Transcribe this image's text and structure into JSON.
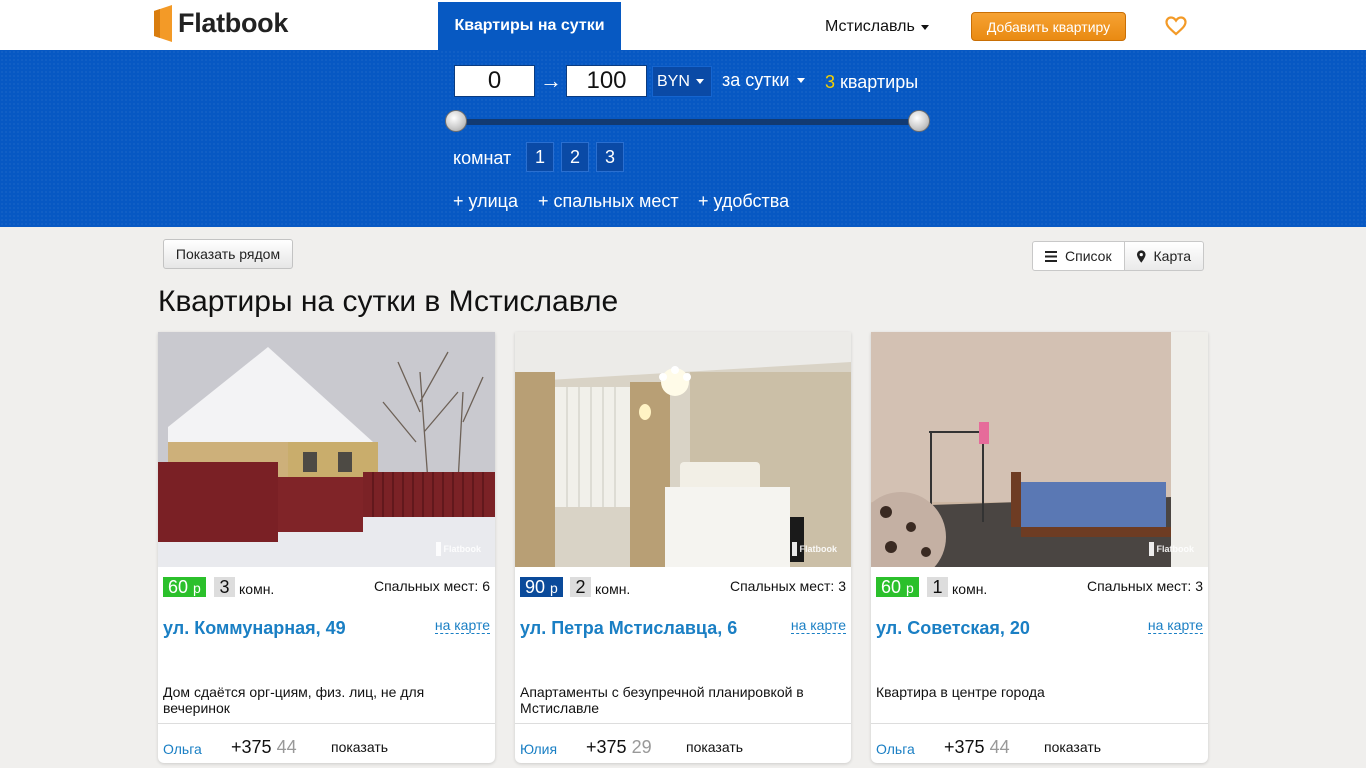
{
  "header": {
    "logo_text": "Flatbook",
    "nav_tab": "Квартиры на сутки",
    "city": "Мстиславль",
    "add_button": "Добавить квартиру"
  },
  "filters": {
    "price_min": "0",
    "price_max": "100",
    "arrow": "→",
    "currency": "BYN",
    "period": "за сутки",
    "count_number": "3",
    "count_label": "квартиры",
    "slider_min_fraction": 0.0,
    "slider_max_fraction": 1.0,
    "rooms_label": "комнат",
    "room_options": [
      "1",
      "2",
      "3"
    ],
    "more_street": "+ улица",
    "more_beds": "+ спальных мест",
    "more_amenities": "+ удобства"
  },
  "toolbar": {
    "near_button": "Показать рядом",
    "view_list": "Список",
    "view_map": "Карта"
  },
  "page_title": "Квартиры на сутки в Мстиславле",
  "colors": {
    "brand_blue": "#0758c3",
    "accent_orange": "#f39a27",
    "price_green": "#2bc02b",
    "price_blue": "#0a4a9a",
    "link_blue": "#1a7fc4"
  },
  "listings": [
    {
      "price": "60",
      "price_unit": "р",
      "price_color": "#2bc02b",
      "rooms": "3",
      "rooms_unit": "комн.",
      "sleeping": "Спальных мест: 6",
      "address": "ул. Коммунарная, 49",
      "map_link": "на карте",
      "description": "Дом сдаётся орг-циям, физ. лиц, не для вечеринок",
      "watermark": "Flatbook",
      "host": "Ольга",
      "phone_visible": "+375",
      "phone_faded": "44",
      "show_label": "показать"
    },
    {
      "price": "90",
      "price_unit": "р",
      "price_color": "#0a4a9a",
      "rooms": "2",
      "rooms_unit": "комн.",
      "sleeping": "Спальных мест: 3",
      "address": "ул. Петра Мстиславца, 6",
      "map_link": "на карте",
      "description": "Апартаменты с безупречной планировкой в Мстиславле",
      "watermark": "Flatbook",
      "host": "Юлия",
      "phone_visible": "+375",
      "phone_faded": "29",
      "show_label": "показать"
    },
    {
      "price": "60",
      "price_unit": "р",
      "price_color": "#2bc02b",
      "rooms": "1",
      "rooms_unit": "комн.",
      "sleeping": "Спальных мест: 3",
      "address": "ул. Советская, 20",
      "map_link": "на карте",
      "description": "Квартира в центре города",
      "watermark": "Flatbook",
      "host": "Ольга",
      "phone_visible": "+375",
      "phone_faded": "44",
      "show_label": "показать"
    }
  ]
}
